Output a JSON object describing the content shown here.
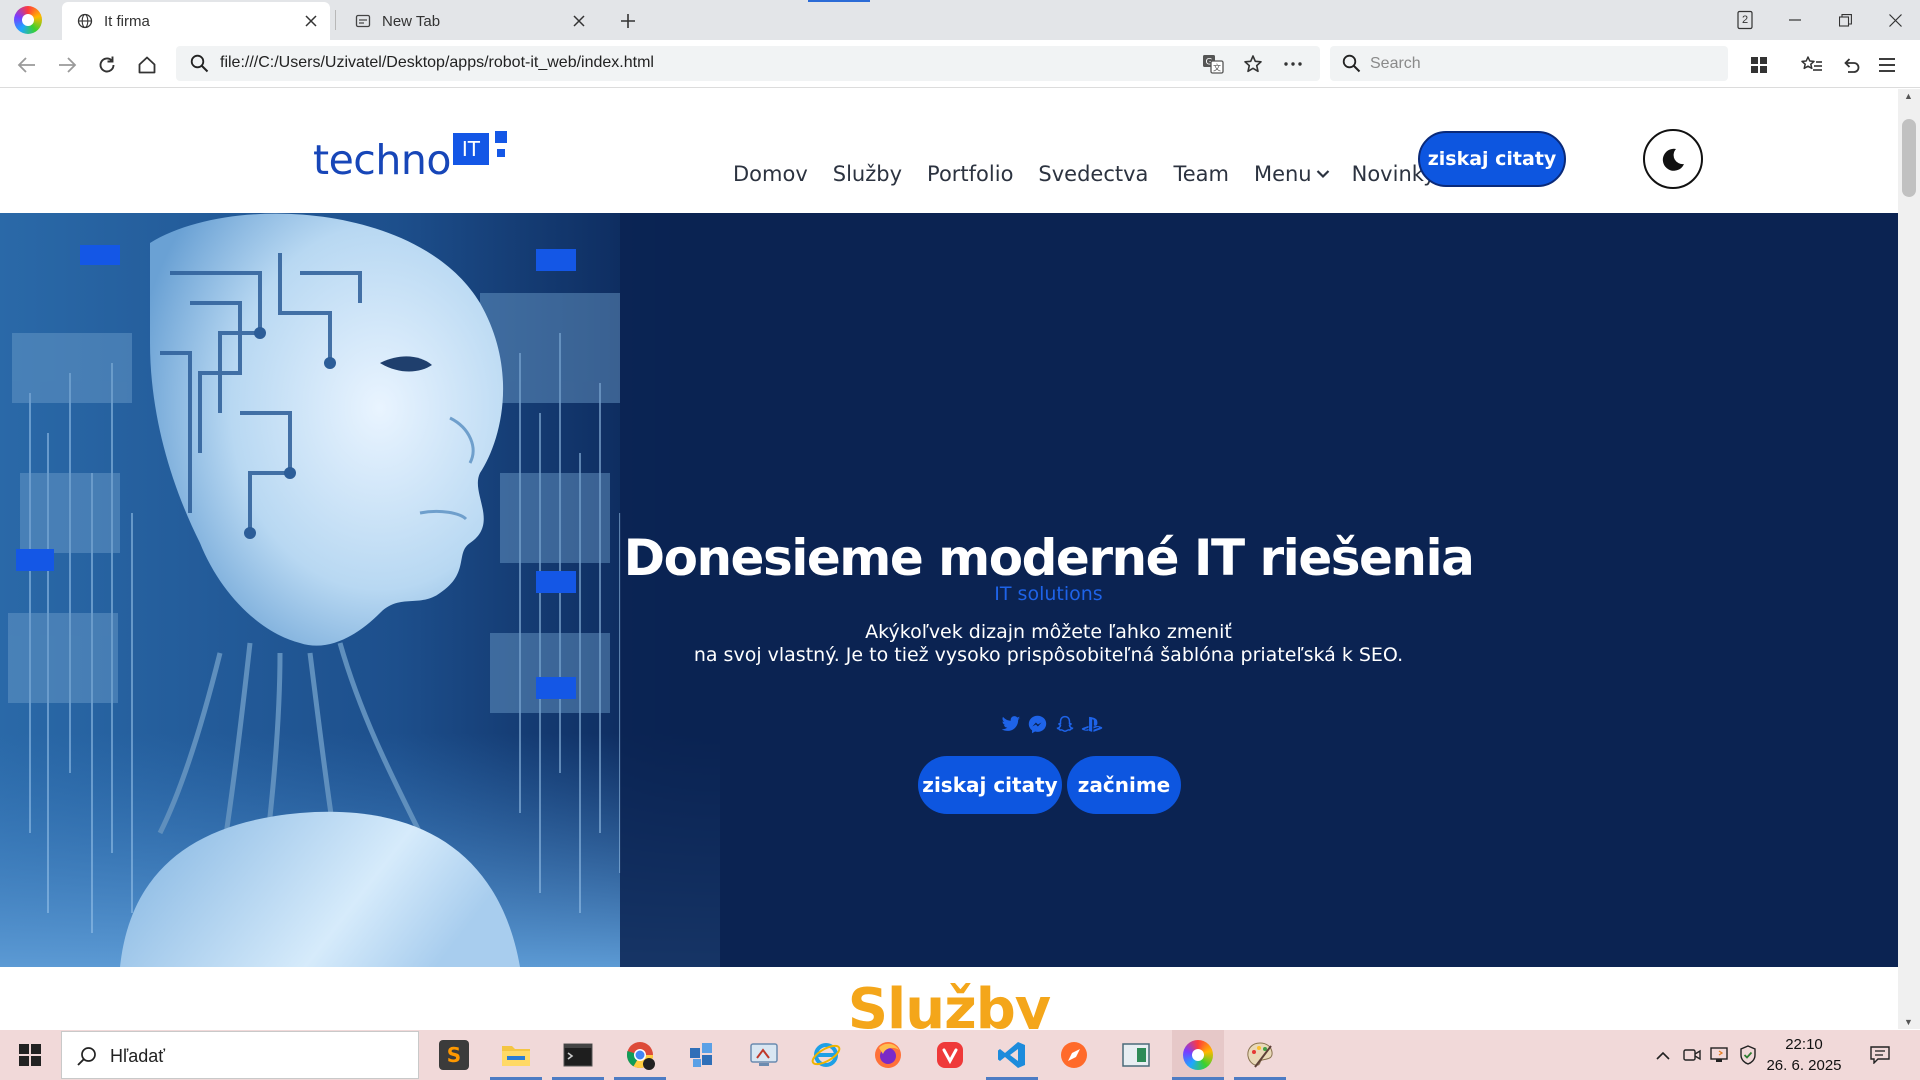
{
  "browser": {
    "tabs": [
      {
        "title": "It firma",
        "active": true
      },
      {
        "title": "New Tab",
        "active": false
      }
    ],
    "tab_count": "2",
    "url": "file:///C:/Users/Uzivatel/Desktop/apps/robot-it_web/index.html",
    "search_placeholder": "Search"
  },
  "site": {
    "logo_text": "techno",
    "logo_badge": "IT",
    "nav": [
      "Domov",
      "Služby",
      "Portfolio",
      "Svedectva",
      "Team",
      "Menu",
      "Novinky"
    ],
    "header_cta": "ziskaj citaty",
    "hero": {
      "title": "Donesieme moderné IT riešenia",
      "subtitle": "IT solutions",
      "description_line1": "Akýkoľvek dizajn môžete ľahko zmeniť",
      "description_line2": "na svoj vlastný. Je to tiež vysoko prispôsobiteľná šablóna priateľská k SEO.",
      "socials": [
        "twitter-icon",
        "messenger-icon",
        "snapchat-icon",
        "playstation-icon"
      ],
      "button_primary": "ziskaj citaty",
      "button_secondary": "začnime"
    },
    "next_section_title": "Služby",
    "colors": {
      "accent": "#0d56e0",
      "hero_bg": "#0b2352",
      "heading_orange": "#f4a61a",
      "logo_blue": "#1746b8"
    }
  },
  "taskbar": {
    "search_placeholder": "Hľadať",
    "apps": [
      "sublime-text",
      "file-explorer",
      "terminal",
      "chrome",
      "app-blocks",
      "remote-desktop",
      "internet-explorer",
      "firefox",
      "vivaldi",
      "vscode",
      "brave-alt",
      "app-window",
      "browser-active",
      "paint"
    ],
    "time": "22:10",
    "date": "26. 6. 2025"
  }
}
